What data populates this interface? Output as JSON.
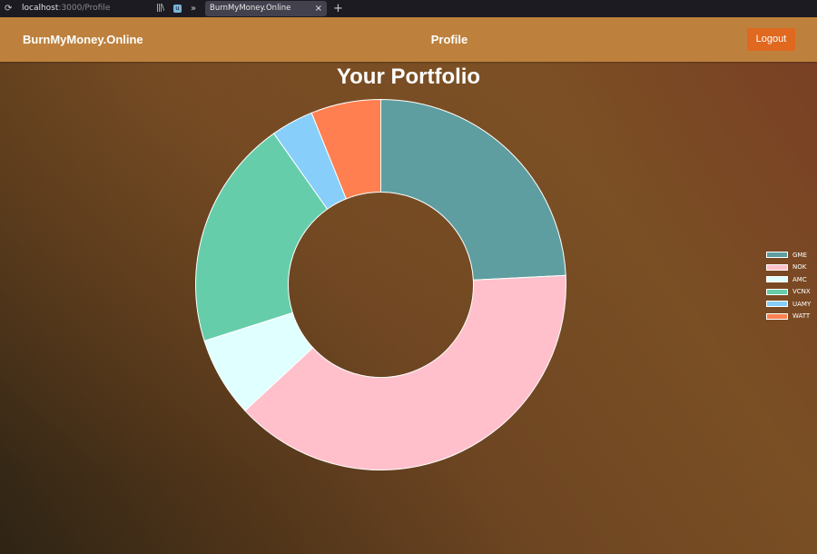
{
  "browser": {
    "url_host": "localhost",
    "url_path": ":3000/Profile",
    "tab_title": "BurnMyMoney.Online",
    "tab_close": "×",
    "new_tab": "+",
    "icons": [
      "reload-icon",
      "library-icon",
      "ublock-icon",
      "overflow-icon",
      "close-icon",
      "new-tab-icon"
    ]
  },
  "navbar": {
    "brand": "BurnMyMoney.Online",
    "title": "Profile",
    "logout_label": "Logout",
    "background": "#bd813d",
    "logout_color": "#e0681f"
  },
  "page": {
    "title": "Your Portfolio"
  },
  "chart_data": {
    "type": "doughnut",
    "title": "Your Portfolio",
    "legend_position": "right",
    "categories": [
      "GME",
      "NOK",
      "AMC",
      "VCNX",
      "UAMY",
      "WATT"
    ],
    "values": [
      24.2,
      38.9,
      7.0,
      20.1,
      3.7,
      6.1
    ],
    "colors": [
      "#5f9ea0",
      "#ffc0cb",
      "#e0ffff",
      "#66cdaa",
      "#87cefa",
      "#ff7f50"
    ]
  }
}
